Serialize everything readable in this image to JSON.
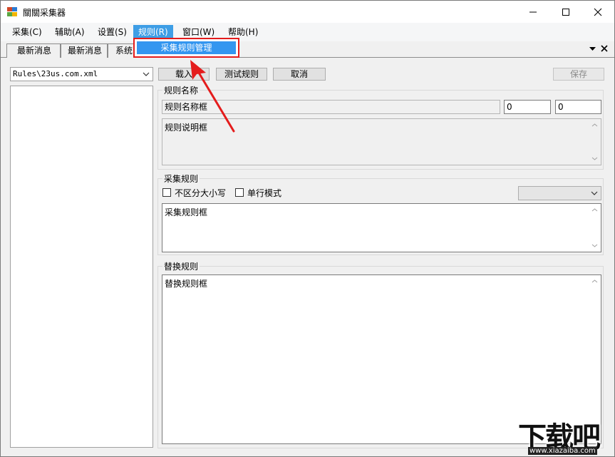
{
  "window": {
    "title": "關關采集器",
    "icons": {
      "minimize": "minimize-icon",
      "maximize": "maximize-icon",
      "close": "close-icon"
    }
  },
  "menubar": {
    "items": [
      {
        "label": "采集(C)"
      },
      {
        "label": "辅助(A)"
      },
      {
        "label": "设置(S)"
      },
      {
        "label": "规则(R)"
      },
      {
        "label": "窗口(W)"
      },
      {
        "label": "帮助(H)"
      }
    ],
    "active_index": 3
  },
  "dropdown": {
    "items": [
      {
        "label": "采集规则管理"
      }
    ]
  },
  "tabs": [
    {
      "label": "最新消息"
    },
    {
      "label": "最新消息"
    },
    {
      "label": "系统"
    }
  ],
  "left_panel": {
    "rule_file": "Rules\\23us.com.xml"
  },
  "toolbar": {
    "load_label": "载入",
    "test_label": "测试规则",
    "cancel_label": "取消",
    "save_label": "保存"
  },
  "rule_name_group": {
    "title": "规则名称",
    "name_field": "规则名称框",
    "value_1": "0",
    "value_2": "0",
    "description_field": "规则说明框"
  },
  "collect_group": {
    "title": "采集规则",
    "case_insensitive_label": "不区分大小写",
    "single_line_label": "单行模式",
    "rule_field": "采集规则框"
  },
  "replace_group": {
    "title": "替换规则",
    "rule_field": "替换规则框"
  },
  "watermark": {
    "text": "下载吧",
    "url": "www.xiazaiba.com"
  },
  "colors": {
    "menu_active": "#3e9ee6",
    "highlight_box": "#e41c1c",
    "annotation_arrow": "#e41c1c"
  }
}
